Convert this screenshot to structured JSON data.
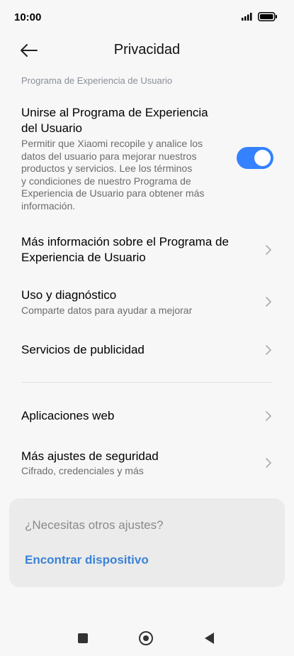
{
  "status_bar": {
    "time": "10:00"
  },
  "header": {
    "title": "Privacidad"
  },
  "section_label": "Programa de Experiencia de Usuario",
  "join_program": {
    "title_line1": "Unirse al Programa de Experiencia",
    "title_line2": "del Usuario",
    "desc_lines": [
      "Permitir que Xiaomi recopile y analice los",
      "datos del usuario para mejorar nuestros",
      "productos y servicios. Lee los términos",
      "y condiciones de nuestro Programa de",
      "Experiencia de Usuario para obtener más",
      "información."
    ],
    "toggle_state": "on"
  },
  "rows": {
    "more_info": {
      "line1": "Más información sobre el Programa de",
      "line2": "Experiencia de Usuario"
    },
    "diagnostics": {
      "title": "Uso y diagnóstico",
      "subtitle": "Comparte datos para ayudar a mejorar"
    },
    "ads": {
      "title": "Servicios de publicidad"
    },
    "web_apps": {
      "title": "Aplicaciones web"
    },
    "security": {
      "title": "Más ajustes de seguridad",
      "subtitle": "Cifrado, credenciales y más"
    }
  },
  "card": {
    "question": "¿Necesitas otros ajustes?",
    "link": "Encontrar dispositivo"
  },
  "colors": {
    "accent": "#3482ff",
    "link": "#3a82d6"
  }
}
